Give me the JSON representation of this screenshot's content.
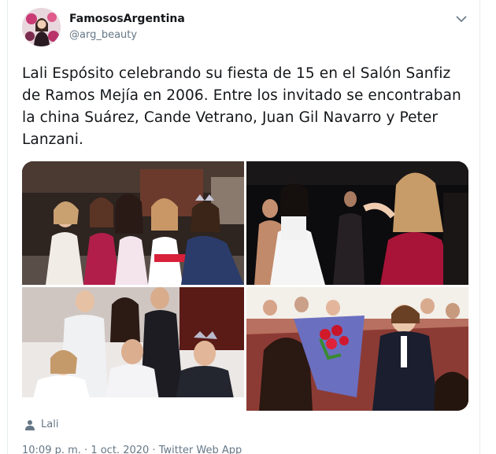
{
  "author": {
    "display_name": "FamososArgentina",
    "handle": "@arg_beauty",
    "avatar_icon": "avatar-photo"
  },
  "tweet": {
    "text": "Lali Espósito celebrando su fiesta de 15 en el Salón Sanfiz de Ramos Mejía en 2006. Entre los invitado se encontraban la china Suárez, Cande Vetrano, Juan Gil Navarro y Peter Lanzani."
  },
  "media": {
    "count": 4,
    "photos": [
      "photo-group-girls",
      "photo-dance-floor",
      "photo-table-group",
      "photo-bouquet-crowd"
    ]
  },
  "tagged": {
    "icon": "person-icon",
    "label": "Lali"
  },
  "footer": {
    "time": "10:09 p. m.",
    "separator": " · ",
    "date": "1 oct. 2020",
    "source": "Twitter Web App"
  },
  "colors": {
    "text": "#14171a",
    "secondary": "#657786",
    "border": "#e6ecf0"
  }
}
